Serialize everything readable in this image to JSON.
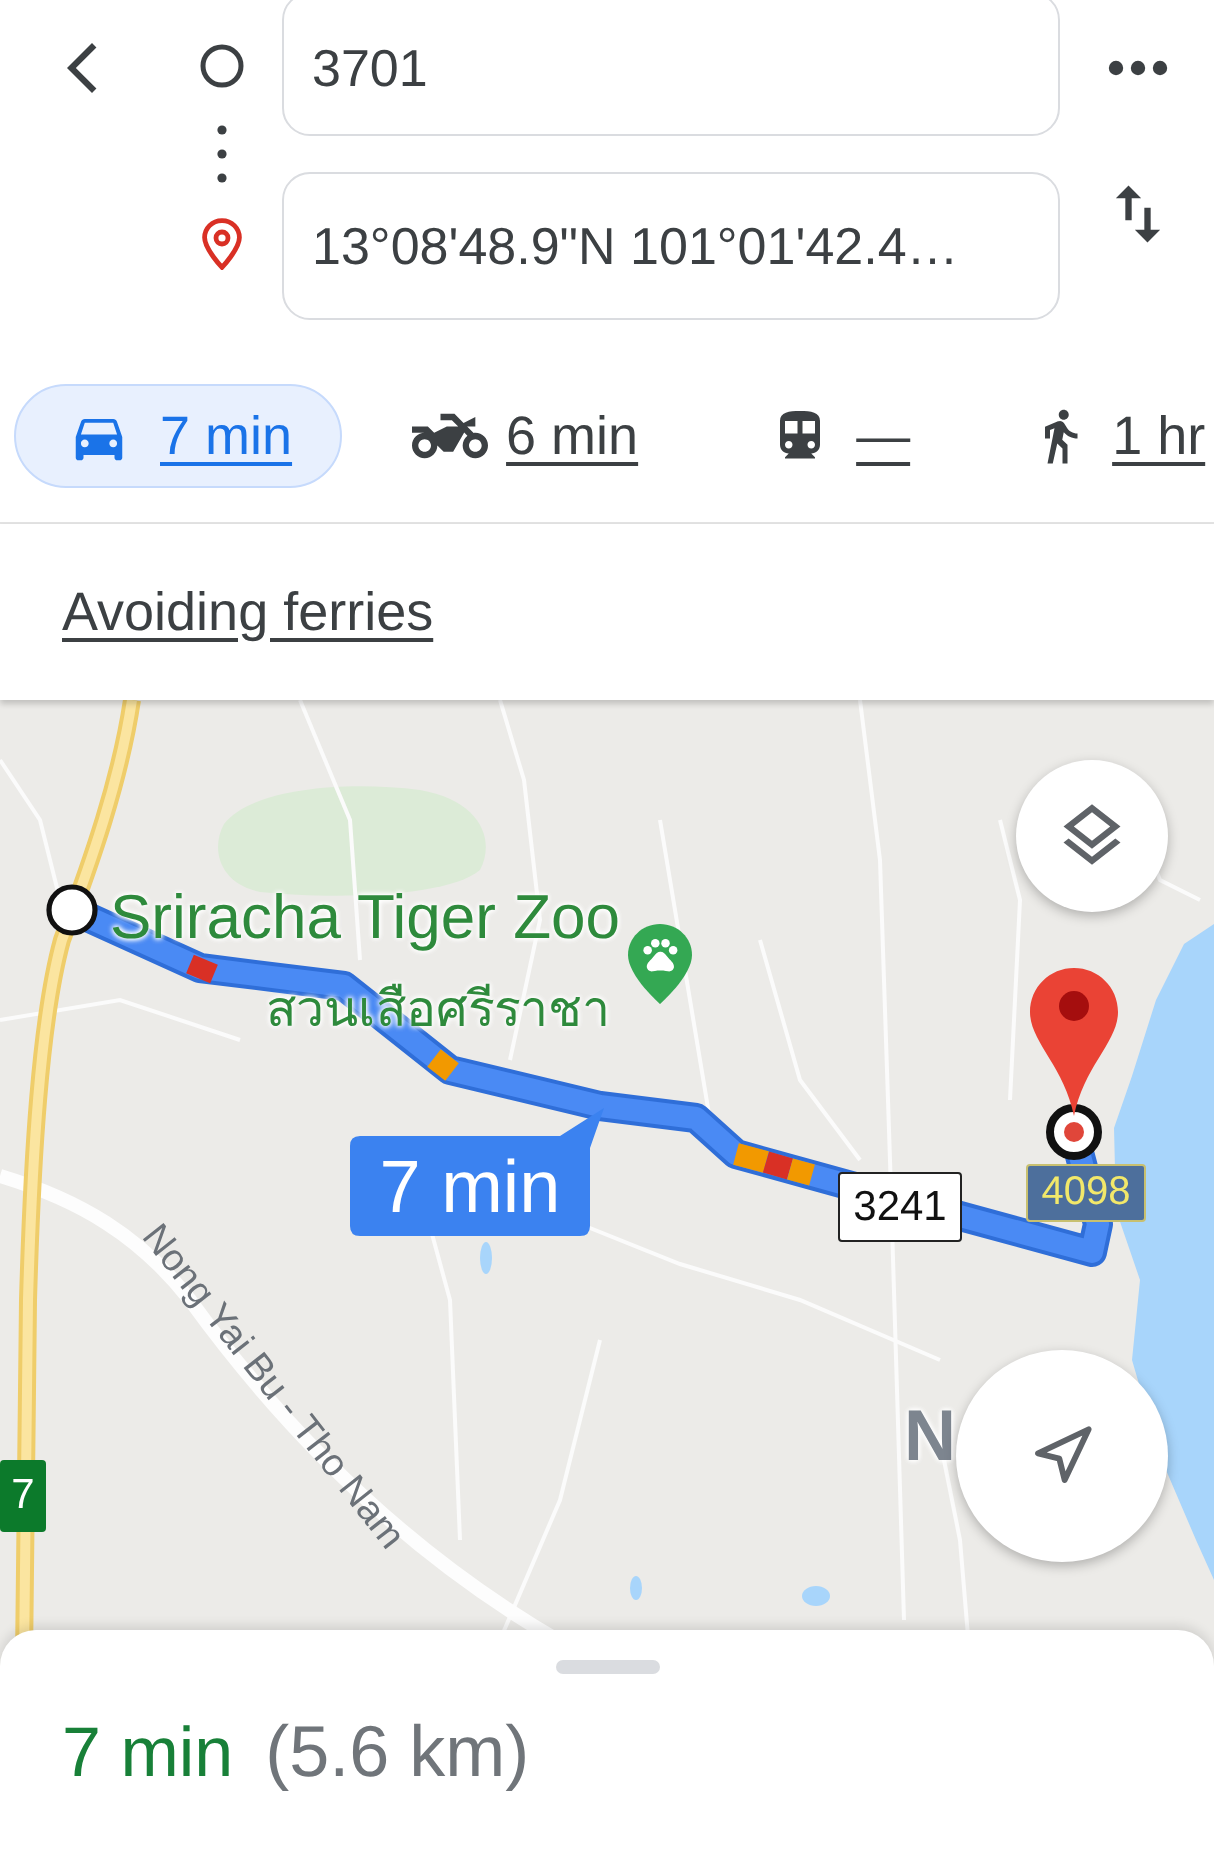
{
  "route": {
    "fields": [
      {
        "kind": "origin",
        "value": "3701"
      },
      {
        "kind": "destination",
        "value": "13°08'48.9\"N 101°01'42.4…"
      }
    ]
  },
  "modes": [
    {
      "kind": "car",
      "label": "7 min",
      "selected": true
    },
    {
      "kind": "motorcycle",
      "label": "6 min",
      "selected": false
    },
    {
      "kind": "transit",
      "label": "—",
      "selected": false
    },
    {
      "kind": "walk",
      "label": "1 hr",
      "selected": false
    }
  ],
  "options": {
    "link": "Avoiding ferries"
  },
  "map": {
    "place": {
      "name": "Sriracha Tiger Zoo",
      "name_local": "สวนเสือศรีราชา"
    },
    "route_label": "7 min",
    "road_name": "Nong Yai Bu - Tho Nam",
    "shields": [
      {
        "kind": "white",
        "text": "3241"
      },
      {
        "kind": "blue",
        "text": "4098"
      },
      {
        "kind": "green",
        "text": "7"
      }
    ],
    "area_label": "N"
  },
  "summary": {
    "duration": "7 min",
    "distance": "(5.6 km)"
  }
}
